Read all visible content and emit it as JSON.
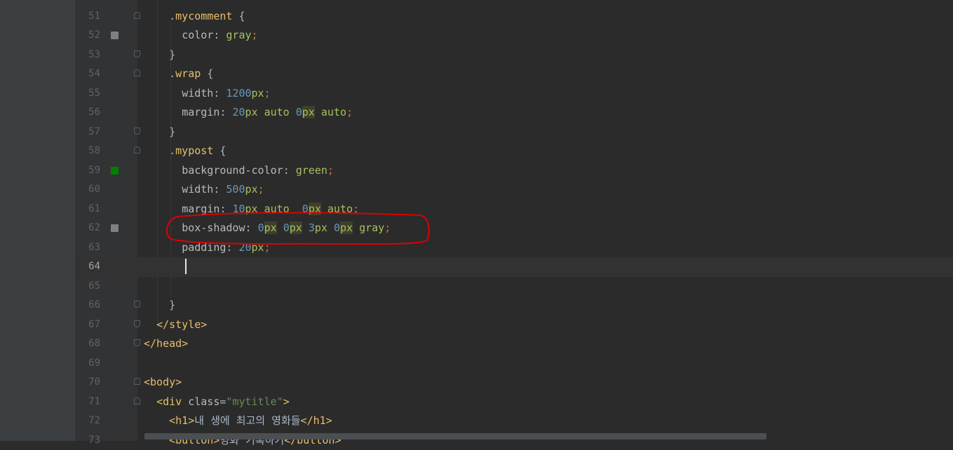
{
  "editor": {
    "lines": [
      {
        "num": "51",
        "marker": "",
        "fold": "start",
        "current": false,
        "segs": [
          {
            "t": "    ",
            "c": "txt"
          },
          {
            "t": ".",
            "c": "txt"
          },
          {
            "t": "mycomment",
            "c": "sel"
          },
          {
            "t": " {",
            "c": "txt"
          }
        ]
      },
      {
        "num": "52",
        "marker": "gray",
        "fold": "",
        "current": false,
        "segs": [
          {
            "t": "      ",
            "c": "txt"
          },
          {
            "t": "color",
            "c": "prop"
          },
          {
            "t": ": ",
            "c": "txt"
          },
          {
            "t": "gray",
            "c": "val"
          },
          {
            "t": ";",
            "c": "kw"
          }
        ]
      },
      {
        "num": "53",
        "marker": "",
        "fold": "end",
        "current": false,
        "segs": [
          {
            "t": "    }",
            "c": "txt"
          }
        ]
      },
      {
        "num": "54",
        "marker": "",
        "fold": "start",
        "current": false,
        "segs": [
          {
            "t": "    ",
            "c": "txt"
          },
          {
            "t": ".",
            "c": "txt"
          },
          {
            "t": "wrap",
            "c": "sel"
          },
          {
            "t": " {",
            "c": "txt"
          }
        ]
      },
      {
        "num": "55",
        "marker": "",
        "fold": "",
        "current": false,
        "segs": [
          {
            "t": "      ",
            "c": "txt"
          },
          {
            "t": "width",
            "c": "prop"
          },
          {
            "t": ": ",
            "c": "txt"
          },
          {
            "t": "1200",
            "c": "num"
          },
          {
            "t": "px",
            "c": "val"
          },
          {
            "t": ";",
            "c": "kw"
          }
        ]
      },
      {
        "num": "56",
        "marker": "",
        "fold": "",
        "current": false,
        "segs": [
          {
            "t": "      ",
            "c": "txt"
          },
          {
            "t": "margin",
            "c": "prop"
          },
          {
            "t": ": ",
            "c": "txt"
          },
          {
            "t": "20",
            "c": "num"
          },
          {
            "t": "px",
            "c": "val"
          },
          {
            "t": " ",
            "c": "txt"
          },
          {
            "t": "auto",
            "c": "val"
          },
          {
            "t": " ",
            "c": "txt"
          },
          {
            "t": "0",
            "c": "num"
          },
          {
            "t": "px",
            "c": "val hl"
          },
          {
            "t": " ",
            "c": "txt"
          },
          {
            "t": "auto",
            "c": "val"
          },
          {
            "t": ";",
            "c": "kw"
          }
        ]
      },
      {
        "num": "57",
        "marker": "",
        "fold": "end",
        "current": false,
        "segs": [
          {
            "t": "    }",
            "c": "txt"
          }
        ]
      },
      {
        "num": "58",
        "marker": "",
        "fold": "start",
        "current": false,
        "segs": [
          {
            "t": "    ",
            "c": "txt"
          },
          {
            "t": ".",
            "c": "txt"
          },
          {
            "t": "mypost",
            "c": "sel"
          },
          {
            "t": " {",
            "c": "txt"
          }
        ]
      },
      {
        "num": "59",
        "marker": "green",
        "fold": "",
        "current": false,
        "segs": [
          {
            "t": "      ",
            "c": "txt"
          },
          {
            "t": "background-color",
            "c": "prop"
          },
          {
            "t": ": ",
            "c": "txt"
          },
          {
            "t": "green",
            "c": "val"
          },
          {
            "t": ";",
            "c": "kw"
          }
        ]
      },
      {
        "num": "60",
        "marker": "",
        "fold": "",
        "current": false,
        "segs": [
          {
            "t": "      ",
            "c": "txt"
          },
          {
            "t": "width",
            "c": "prop"
          },
          {
            "t": ": ",
            "c": "txt"
          },
          {
            "t": "500",
            "c": "num"
          },
          {
            "t": "px",
            "c": "val"
          },
          {
            "t": ";",
            "c": "kw"
          }
        ]
      },
      {
        "num": "61",
        "marker": "",
        "fold": "",
        "current": false,
        "segs": [
          {
            "t": "      ",
            "c": "txt"
          },
          {
            "t": "margin",
            "c": "prop"
          },
          {
            "t": ": ",
            "c": "txt"
          },
          {
            "t": "10",
            "c": "num"
          },
          {
            "t": "px",
            "c": "val"
          },
          {
            "t": " ",
            "c": "txt"
          },
          {
            "t": "auto",
            "c": "val"
          },
          {
            "t": "  ",
            "c": "txt"
          },
          {
            "t": "0",
            "c": "num"
          },
          {
            "t": "px",
            "c": "val hl"
          },
          {
            "t": " ",
            "c": "txt"
          },
          {
            "t": "auto",
            "c": "val"
          },
          {
            "t": ";",
            "c": "kw"
          }
        ]
      },
      {
        "num": "62",
        "marker": "gray",
        "fold": "",
        "current": false,
        "segs": [
          {
            "t": "      ",
            "c": "txt"
          },
          {
            "t": "box-shadow",
            "c": "prop"
          },
          {
            "t": ": ",
            "c": "txt"
          },
          {
            "t": "0",
            "c": "num"
          },
          {
            "t": "px",
            "c": "val hl"
          },
          {
            "t": " ",
            "c": "txt"
          },
          {
            "t": "0",
            "c": "num"
          },
          {
            "t": "px",
            "c": "val hl"
          },
          {
            "t": " ",
            "c": "txt"
          },
          {
            "t": "3",
            "c": "num"
          },
          {
            "t": "px",
            "c": "val"
          },
          {
            "t": " ",
            "c": "txt"
          },
          {
            "t": "0",
            "c": "num"
          },
          {
            "t": "px",
            "c": "val hl"
          },
          {
            "t": " ",
            "c": "txt"
          },
          {
            "t": "gray",
            "c": "val"
          },
          {
            "t": ";",
            "c": "kw"
          }
        ]
      },
      {
        "num": "63",
        "marker": "",
        "fold": "",
        "current": false,
        "segs": [
          {
            "t": "      ",
            "c": "txt"
          },
          {
            "t": "padding",
            "c": "prop"
          },
          {
            "t": ": ",
            "c": "txt"
          },
          {
            "t": "20",
            "c": "num"
          },
          {
            "t": "px",
            "c": "val"
          },
          {
            "t": ";",
            "c": "kw"
          }
        ]
      },
      {
        "num": "64",
        "marker": "",
        "fold": "",
        "current": true,
        "segs": []
      },
      {
        "num": "65",
        "marker": "",
        "fold": "",
        "current": false,
        "segs": []
      },
      {
        "num": "66",
        "marker": "",
        "fold": "end",
        "current": false,
        "segs": [
          {
            "t": "    }",
            "c": "txt"
          }
        ]
      },
      {
        "num": "67",
        "marker": "",
        "fold": "end",
        "current": false,
        "segs": [
          {
            "t": "  ",
            "c": "txt"
          },
          {
            "t": "</style>",
            "c": "tag"
          }
        ]
      },
      {
        "num": "68",
        "marker": "",
        "fold": "end",
        "current": false,
        "segs": [
          {
            "t": "</head>",
            "c": "tag"
          }
        ]
      },
      {
        "num": "69",
        "marker": "",
        "fold": "",
        "current": false,
        "segs": []
      },
      {
        "num": "70",
        "marker": "",
        "fold": "start",
        "current": false,
        "segs": [
          {
            "t": "<body>",
            "c": "tag"
          }
        ]
      },
      {
        "num": "71",
        "marker": "",
        "fold": "start",
        "current": false,
        "segs": [
          {
            "t": "  ",
            "c": "txt"
          },
          {
            "t": "<div ",
            "c": "tag"
          },
          {
            "t": "class",
            "c": "attr"
          },
          {
            "t": "=",
            "c": "txt"
          },
          {
            "t": "\"mytitle\"",
            "c": "str"
          },
          {
            "t": ">",
            "c": "tag"
          }
        ]
      },
      {
        "num": "72",
        "marker": "",
        "fold": "",
        "current": false,
        "segs": [
          {
            "t": "    ",
            "c": "txt"
          },
          {
            "t": "<h1>",
            "c": "tag"
          },
          {
            "t": "내 생에 최고의 영화들",
            "c": "txt"
          },
          {
            "t": "</h1>",
            "c": "tag"
          }
        ]
      },
      {
        "num": "73",
        "marker": "",
        "fold": "",
        "current": false,
        "segs": [
          {
            "t": "    ",
            "c": "txt"
          },
          {
            "t": "<button>",
            "c": "tag"
          },
          {
            "t": "영화 기록하기",
            "c": "txt"
          },
          {
            "t": "</button>",
            "c": "tag"
          }
        ]
      }
    ],
    "colors": {
      "marker_gray": "#808080",
      "marker_green": "#008000",
      "annotation": "#e00000"
    }
  }
}
